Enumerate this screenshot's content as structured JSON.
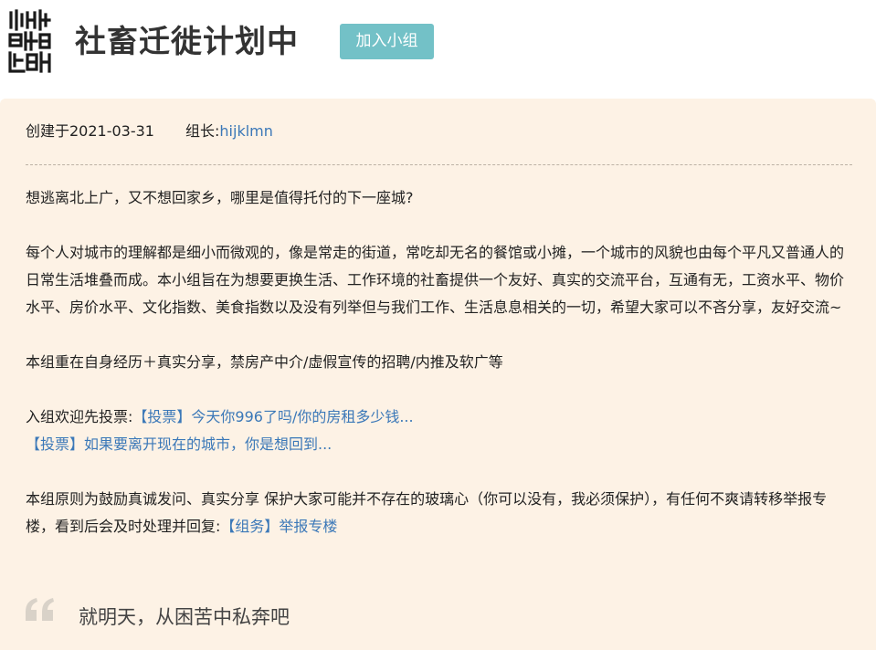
{
  "header": {
    "title": "社畜迁徙计划中",
    "join_button": "加入小组",
    "logo_icon": "seal-logo-icon"
  },
  "meta": {
    "created": "创建于2021-03-31",
    "leader_label": "组长:",
    "leader_name": "hijklmn"
  },
  "description": {
    "p1": "想逃离北上广，又不想回家乡，哪里是值得托付的下一座城?",
    "p2": "每个人对城市的理解都是细小而微观的，像是常走的街道，常吃却无名的餐馆或小摊，一个城市的风貌也由每个平凡又普通人的日常生活堆叠而成。本小组旨在为想要更换生活、工作环境的社畜提供一个友好、真实的交流平台，互通有无，工资水平、物价水平、房价水平、文化指数、美食指数以及没有列举但与我们工作、生活息息相关的一切，希望大家可以不吝分享，友好交流~",
    "p3": "本组重在自身经历＋真实分享，禁房产中介/虚假宣传的招聘/内推及软广等",
    "vote_intro": "入组欢迎先投票:",
    "vote_link_1": "【投票】今天你996了吗/你的房租多少钱...",
    "vote_link_2": "【投票】如果要离开现在的城市，你是想回到...",
    "p5": "本组原则为鼓励真诚发问、真实分享 保护大家可能并不存在的玻璃心（你可以没有，我必须保护），有任何不爽请转移举报专楼，看到后会及时处理并回复:",
    "report_link": "【组务】举报专楼"
  },
  "quote": {
    "text": "就明天，从困苦中私奔吧",
    "icon": "quote-icon"
  },
  "colors": {
    "accent_button": "#73c1c7",
    "panel_background": "#fdf2e5",
    "link": "#3b78b8"
  }
}
